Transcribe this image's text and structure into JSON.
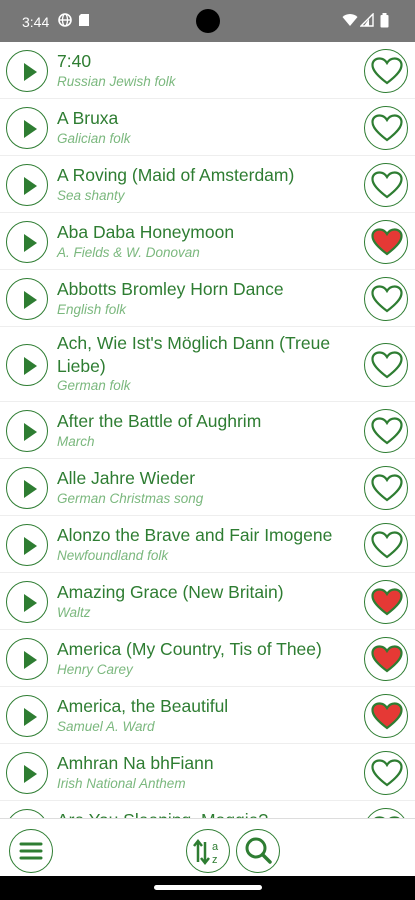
{
  "status_bar": {
    "time": "3:44"
  },
  "songs": [
    {
      "title": "7:40",
      "subtitle": "Russian Jewish folk",
      "favorite": false
    },
    {
      "title": "A Bruxa",
      "subtitle": "Galician folk",
      "favorite": false
    },
    {
      "title": "A Roving (Maid of Amsterdam)",
      "subtitle": "Sea shanty",
      "favorite": false
    },
    {
      "title": "Aba Daba Honeymoon",
      "subtitle": "A. Fields & W. Donovan",
      "favorite": true
    },
    {
      "title": "Abbotts Bromley Horn Dance",
      "subtitle": "English folk",
      "favorite": false
    },
    {
      "title": "Ach, Wie Ist's Möglich Dann (Treue Liebe)",
      "subtitle": "German folk",
      "favorite": false
    },
    {
      "title": "After the Battle of Aughrim",
      "subtitle": "March",
      "favorite": false
    },
    {
      "title": "Alle Jahre Wieder",
      "subtitle": "German Christmas song",
      "favorite": false
    },
    {
      "title": "Alonzo the Brave and Fair Imogene",
      "subtitle": "Newfoundland folk",
      "favorite": false
    },
    {
      "title": "Amazing Grace (New Britain)",
      "subtitle": "Waltz",
      "favorite": true
    },
    {
      "title": "America (My Country, Tis of Thee)",
      "subtitle": "Henry Carey",
      "favorite": true
    },
    {
      "title": "America, the Beautiful",
      "subtitle": "Samuel A. Ward",
      "favorite": true
    },
    {
      "title": "Amhran Na bhFiann",
      "subtitle": "Irish National Anthem",
      "favorite": false
    },
    {
      "title": "Are You Sleeping, Maggie?",
      "subtitle": "",
      "favorite": false
    }
  ],
  "toolbar": {
    "menu_icon": "hamburger-menu-icon",
    "sort_icon": "sort-alphabetical-icon",
    "sort_letters": [
      "a",
      "z"
    ],
    "search_icon": "magnifier-icon"
  },
  "colors": {
    "accent": "#2e7d32",
    "subtitle": "#7bb87e",
    "favorite_fill": "#e53935",
    "status_bar": "#777777"
  }
}
